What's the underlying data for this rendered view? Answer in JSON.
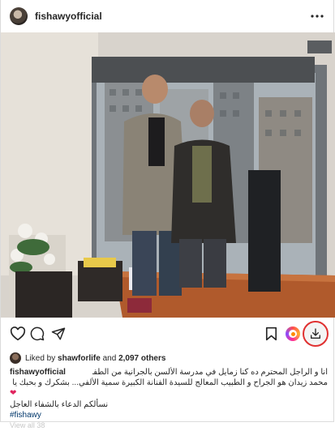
{
  "post": {
    "username": "fishawyofficial",
    "more_icon": "more-horizontal-icon"
  },
  "actions": {
    "like_icon": "heart-icon",
    "comment_icon": "comment-icon",
    "share_icon": "send-icon",
    "save_icon": "bookmark-icon",
    "extension_icon": "colorful-circle-icon",
    "download_icon": "download-icon",
    "download_ring_color": "#e03131"
  },
  "likes": {
    "prefix": "Liked by ",
    "user": "shawforlife",
    "suffix": " and ",
    "count": "2,097 others"
  },
  "caption": {
    "username": "fishawyofficial",
    "line1": "انا و الراجل المحترم ده كنا زمايل في مدرسة الألسن بالجرانية من الطفولة و دلوقتي",
    "line2": "محمد زيدان هو الجراح و الطبيب المعالج للسيدة الفنانة الكبيرة سمية الألفي... بشكرك و بحبك يا صاحبي",
    "heart": "❤",
    "line3": "نسألكم الدعاء بالشفاء العاجل",
    "hashtag": "#fishawy",
    "faded": "View all 38"
  }
}
